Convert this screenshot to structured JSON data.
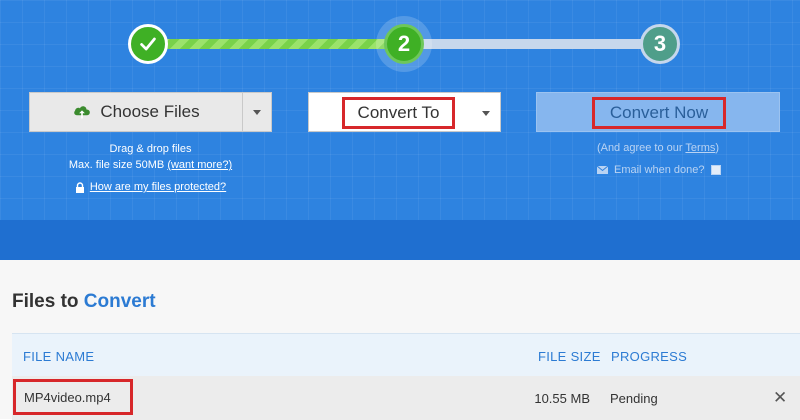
{
  "steps": [
    {
      "label": "",
      "state": "complete"
    },
    {
      "label": "2",
      "state": "active"
    },
    {
      "label": "3",
      "state": "pending"
    }
  ],
  "upload": {
    "choose_label": "Choose Files",
    "drag_text": "Drag & drop files",
    "max_size_text": "Max. file size 50MB",
    "want_more_link": "(want more?)",
    "protected_link": "How are my files protected?"
  },
  "convert_to": {
    "label": "Convert To"
  },
  "convert_now": {
    "label": "Convert Now",
    "agree_prefix": "(And agree to our",
    "terms_link": "Terms",
    "agree_suffix": ")",
    "email_label": "Email when done?"
  },
  "files": {
    "title_prefix": "Files to",
    "title_accent": "Convert",
    "columns": {
      "name": "FILE NAME",
      "size": "FILE SIZE",
      "progress": "PROGRESS"
    },
    "rows": [
      {
        "name": "MP4video.mp4",
        "size": "10.55 MB",
        "status": "Pending"
      }
    ]
  },
  "colors": {
    "hero": "#2e83e0",
    "accent": "#2c7bd3",
    "step_green": "#3fb025",
    "highlight": "#d7272a"
  }
}
